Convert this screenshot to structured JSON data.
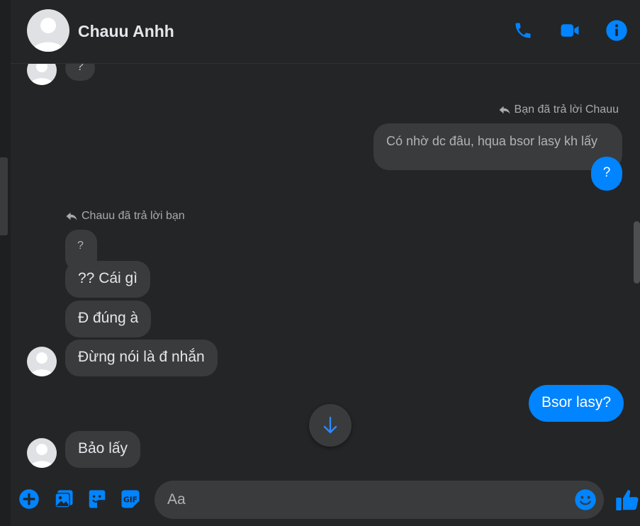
{
  "header": {
    "contact_name": "Chauu Anhh",
    "call_icon": "phone-icon",
    "video_icon": "video-camera-icon",
    "info_icon": "info-icon"
  },
  "messages": {
    "partial_top": {
      "text": "?"
    },
    "my_reply_meta": "Bạn đã trả lời Chauu",
    "my_quoted": "Có nhờ dc đâu, hqua bsor lasy kh lấy",
    "my_reply": "?",
    "their_reply_meta": "Chauu đã trả lời bạn",
    "their_quoted": "?",
    "their_1": "?? Cái gì",
    "their_2": "Đ đúng à",
    "their_3": "Đừng nói là đ nhắn",
    "my_2": "Bsor lasy?",
    "their_4": "Bảo lấy"
  },
  "composer": {
    "placeholder": "Aa",
    "icons": [
      "add-icon",
      "photo-icon",
      "sticker-icon",
      "gif-icon",
      "emoji-icon",
      "like-icon"
    ],
    "gif_label": "GIF"
  },
  "colors": {
    "accent": "#0084ff",
    "background": "#242526",
    "bubble_other": "#3a3b3c"
  }
}
